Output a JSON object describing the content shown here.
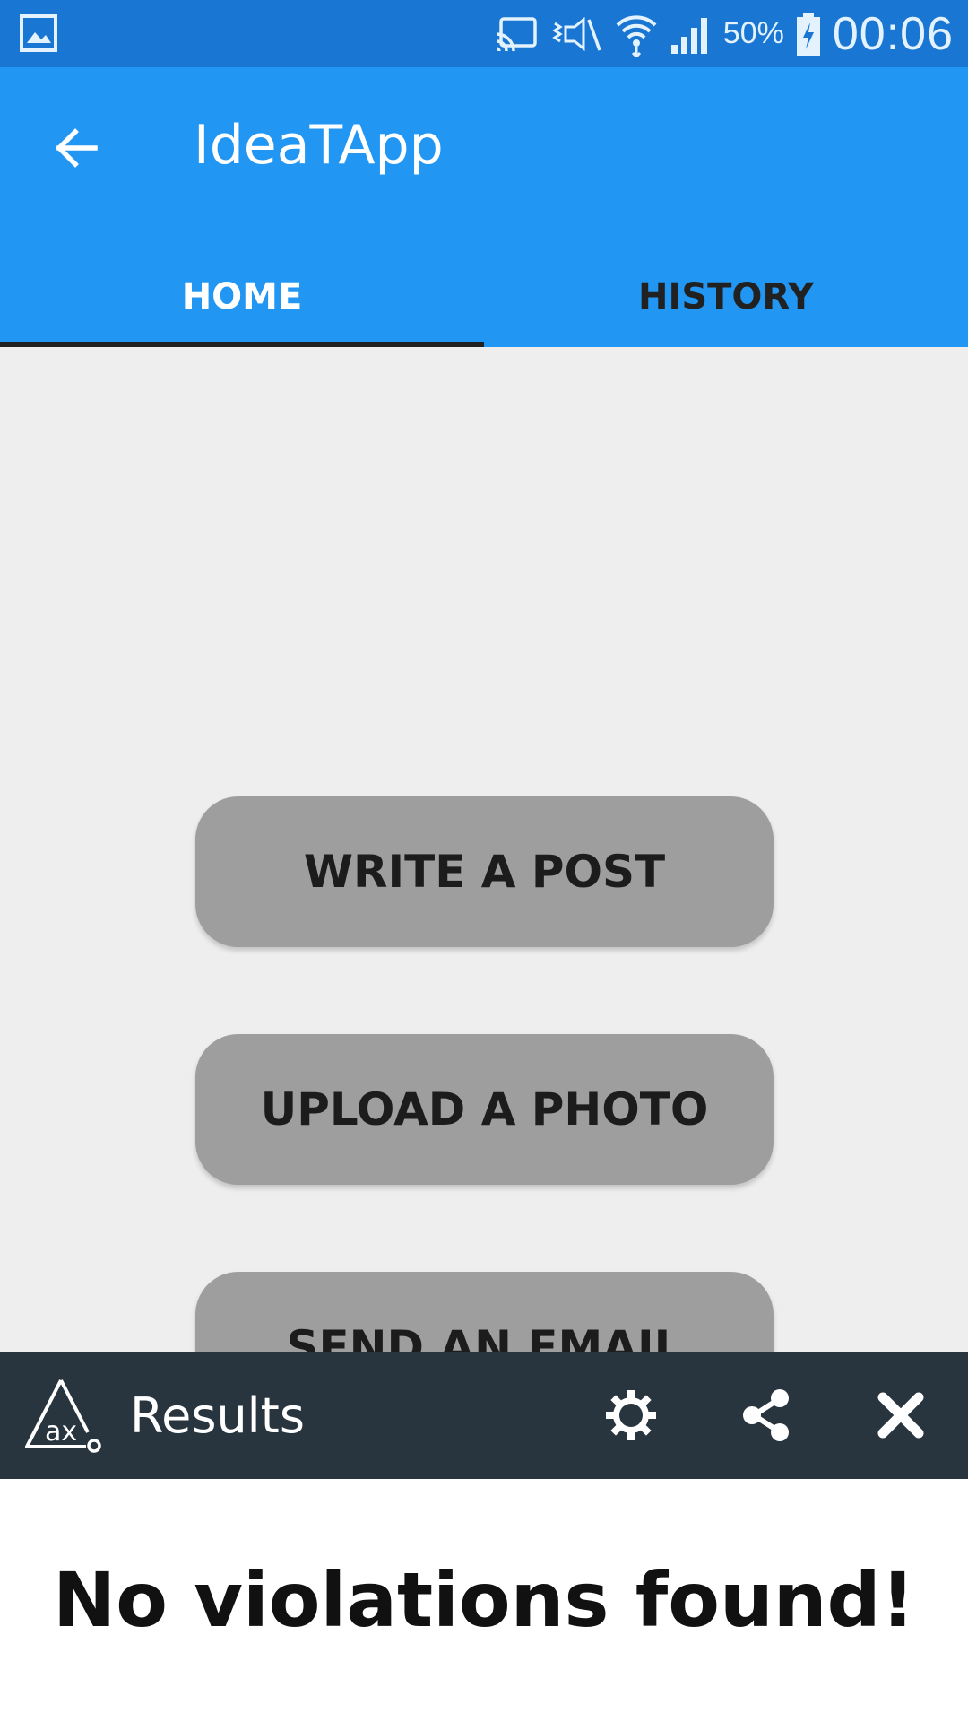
{
  "status_bar": {
    "battery_percent": "50%",
    "time": "00:06",
    "icons": [
      "gallery-icon",
      "cast-icon",
      "vibrate-icon",
      "wifi-icon",
      "signal-icon",
      "battery-charging-icon"
    ]
  },
  "app_bar": {
    "title": "IdeaTApp",
    "back_icon": "arrow-back-icon",
    "tabs": [
      {
        "label": "HOME",
        "selected": true
      },
      {
        "label": "HISTORY",
        "selected": false
      }
    ]
  },
  "main": {
    "buttons": [
      {
        "label": "WRITE A POST"
      },
      {
        "label": "UPLOAD A PHOTO"
      },
      {
        "label": "SEND AN EMAIL"
      }
    ]
  },
  "results_panel": {
    "title": "Results",
    "icons": [
      "ax-logo-icon",
      "settings-icon",
      "share-icon",
      "close-icon"
    ],
    "message": "No violations found!"
  },
  "colors": {
    "status_bar": "#1976d2",
    "app_bar": "#2196f3",
    "button": "#9e9e9e",
    "results_bar": "#28343e"
  }
}
